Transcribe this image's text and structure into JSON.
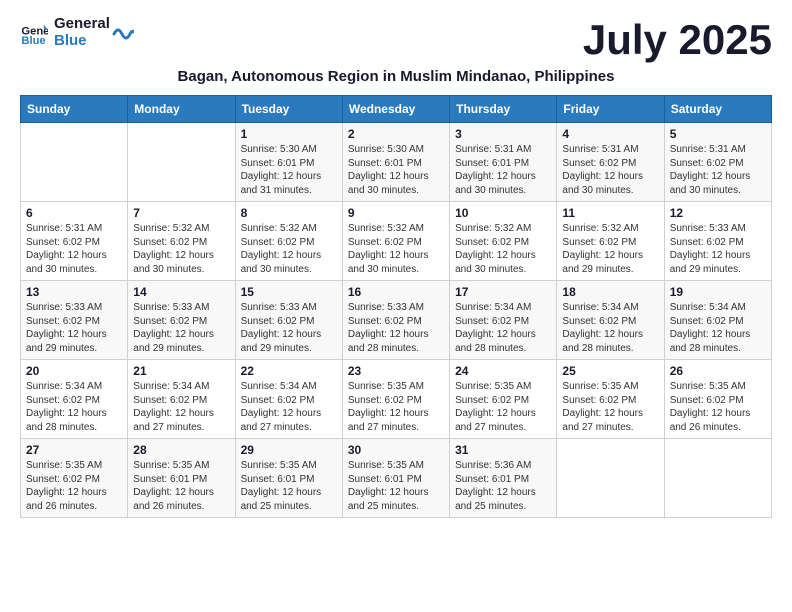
{
  "logo": {
    "line1": "General",
    "line2": "Blue"
  },
  "title": "July 2025",
  "location": "Bagan, Autonomous Region in Muslim Mindanao, Philippines",
  "days_of_week": [
    "Sunday",
    "Monday",
    "Tuesday",
    "Wednesday",
    "Thursday",
    "Friday",
    "Saturday"
  ],
  "weeks": [
    [
      {
        "day": "",
        "detail": ""
      },
      {
        "day": "",
        "detail": ""
      },
      {
        "day": "1",
        "detail": "Sunrise: 5:30 AM\nSunset: 6:01 PM\nDaylight: 12 hours\nand 31 minutes."
      },
      {
        "day": "2",
        "detail": "Sunrise: 5:30 AM\nSunset: 6:01 PM\nDaylight: 12 hours\nand 30 minutes."
      },
      {
        "day": "3",
        "detail": "Sunrise: 5:31 AM\nSunset: 6:01 PM\nDaylight: 12 hours\nand 30 minutes."
      },
      {
        "day": "4",
        "detail": "Sunrise: 5:31 AM\nSunset: 6:02 PM\nDaylight: 12 hours\nand 30 minutes."
      },
      {
        "day": "5",
        "detail": "Sunrise: 5:31 AM\nSunset: 6:02 PM\nDaylight: 12 hours\nand 30 minutes."
      }
    ],
    [
      {
        "day": "6",
        "detail": "Sunrise: 5:31 AM\nSunset: 6:02 PM\nDaylight: 12 hours\nand 30 minutes."
      },
      {
        "day": "7",
        "detail": "Sunrise: 5:32 AM\nSunset: 6:02 PM\nDaylight: 12 hours\nand 30 minutes."
      },
      {
        "day": "8",
        "detail": "Sunrise: 5:32 AM\nSunset: 6:02 PM\nDaylight: 12 hours\nand 30 minutes."
      },
      {
        "day": "9",
        "detail": "Sunrise: 5:32 AM\nSunset: 6:02 PM\nDaylight: 12 hours\nand 30 minutes."
      },
      {
        "day": "10",
        "detail": "Sunrise: 5:32 AM\nSunset: 6:02 PM\nDaylight: 12 hours\nand 30 minutes."
      },
      {
        "day": "11",
        "detail": "Sunrise: 5:32 AM\nSunset: 6:02 PM\nDaylight: 12 hours\nand 29 minutes."
      },
      {
        "day": "12",
        "detail": "Sunrise: 5:33 AM\nSunset: 6:02 PM\nDaylight: 12 hours\nand 29 minutes."
      }
    ],
    [
      {
        "day": "13",
        "detail": "Sunrise: 5:33 AM\nSunset: 6:02 PM\nDaylight: 12 hours\nand 29 minutes."
      },
      {
        "day": "14",
        "detail": "Sunrise: 5:33 AM\nSunset: 6:02 PM\nDaylight: 12 hours\nand 29 minutes."
      },
      {
        "day": "15",
        "detail": "Sunrise: 5:33 AM\nSunset: 6:02 PM\nDaylight: 12 hours\nand 29 minutes."
      },
      {
        "day": "16",
        "detail": "Sunrise: 5:33 AM\nSunset: 6:02 PM\nDaylight: 12 hours\nand 28 minutes."
      },
      {
        "day": "17",
        "detail": "Sunrise: 5:34 AM\nSunset: 6:02 PM\nDaylight: 12 hours\nand 28 minutes."
      },
      {
        "day": "18",
        "detail": "Sunrise: 5:34 AM\nSunset: 6:02 PM\nDaylight: 12 hours\nand 28 minutes."
      },
      {
        "day": "19",
        "detail": "Sunrise: 5:34 AM\nSunset: 6:02 PM\nDaylight: 12 hours\nand 28 minutes."
      }
    ],
    [
      {
        "day": "20",
        "detail": "Sunrise: 5:34 AM\nSunset: 6:02 PM\nDaylight: 12 hours\nand 28 minutes."
      },
      {
        "day": "21",
        "detail": "Sunrise: 5:34 AM\nSunset: 6:02 PM\nDaylight: 12 hours\nand 27 minutes."
      },
      {
        "day": "22",
        "detail": "Sunrise: 5:34 AM\nSunset: 6:02 PM\nDaylight: 12 hours\nand 27 minutes."
      },
      {
        "day": "23",
        "detail": "Sunrise: 5:35 AM\nSunset: 6:02 PM\nDaylight: 12 hours\nand 27 minutes."
      },
      {
        "day": "24",
        "detail": "Sunrise: 5:35 AM\nSunset: 6:02 PM\nDaylight: 12 hours\nand 27 minutes."
      },
      {
        "day": "25",
        "detail": "Sunrise: 5:35 AM\nSunset: 6:02 PM\nDaylight: 12 hours\nand 27 minutes."
      },
      {
        "day": "26",
        "detail": "Sunrise: 5:35 AM\nSunset: 6:02 PM\nDaylight: 12 hours\nand 26 minutes."
      }
    ],
    [
      {
        "day": "27",
        "detail": "Sunrise: 5:35 AM\nSunset: 6:02 PM\nDaylight: 12 hours\nand 26 minutes."
      },
      {
        "day": "28",
        "detail": "Sunrise: 5:35 AM\nSunset: 6:01 PM\nDaylight: 12 hours\nand 26 minutes."
      },
      {
        "day": "29",
        "detail": "Sunrise: 5:35 AM\nSunset: 6:01 PM\nDaylight: 12 hours\nand 25 minutes."
      },
      {
        "day": "30",
        "detail": "Sunrise: 5:35 AM\nSunset: 6:01 PM\nDaylight: 12 hours\nand 25 minutes."
      },
      {
        "day": "31",
        "detail": "Sunrise: 5:36 AM\nSunset: 6:01 PM\nDaylight: 12 hours\nand 25 minutes."
      },
      {
        "day": "",
        "detail": ""
      },
      {
        "day": "",
        "detail": ""
      }
    ]
  ]
}
